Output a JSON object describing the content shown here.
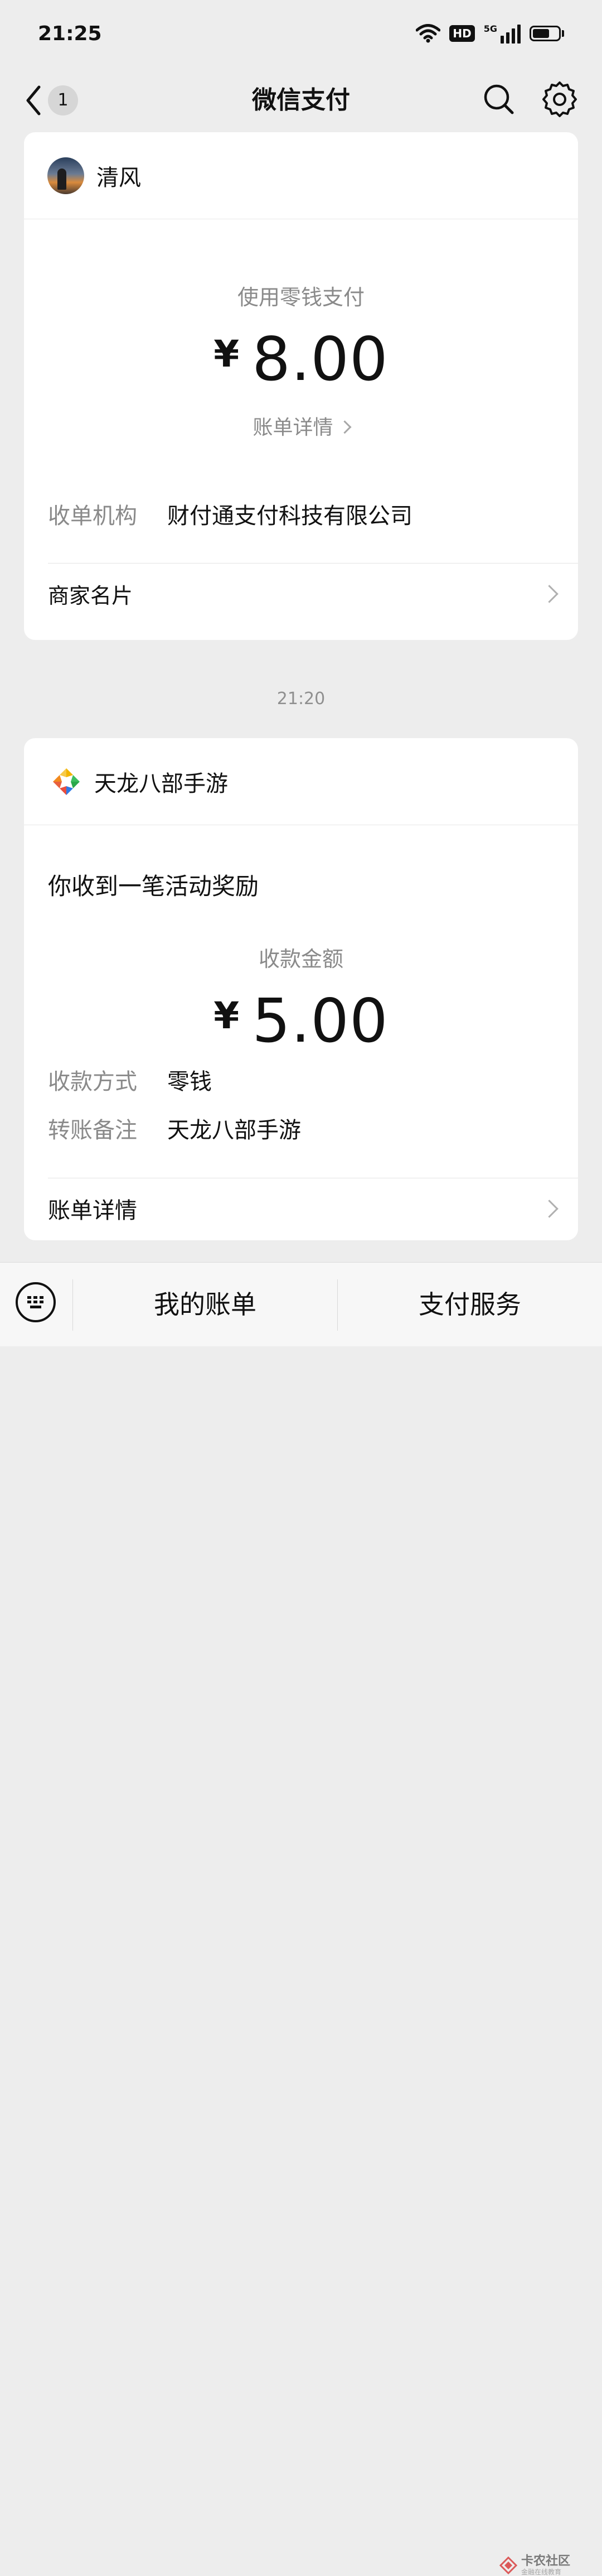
{
  "status_bar": {
    "time": "21:25",
    "hd_label": "HD",
    "network_label": "5G",
    "battery_level": 0.65
  },
  "nav": {
    "back_count": "1",
    "title": "微信支付"
  },
  "payment_card": {
    "payee_name": "清风",
    "pay_method": "使用零钱支付",
    "currency_symbol": "¥",
    "amount": "8.00",
    "bill_detail_link": "账单详情",
    "acquirer_label": "收单机构",
    "acquirer_value": "财付通支付科技有限公司",
    "merchant_card_label": "商家名片"
  },
  "timestamp": "21:20",
  "reward_card": {
    "sender_name": "天龙八部手游",
    "headline": "你收到一笔活动奖励",
    "amount_caption": "收款金额",
    "currency_symbol": "¥",
    "amount": "5.00",
    "method_label": "收款方式",
    "method_value": "零钱",
    "note_label": "转账备注",
    "note_value": "天龙八部手游",
    "bill_detail_label": "账单详情"
  },
  "bottom_bar": {
    "my_bills": "我的账单",
    "pay_services": "支付服务"
  },
  "watermark": {
    "name": "卡农社区",
    "tagline": "金融在线教育"
  },
  "colors": {
    "background": "#ededed",
    "card": "#ffffff",
    "muted_text": "#8a8a8a"
  }
}
